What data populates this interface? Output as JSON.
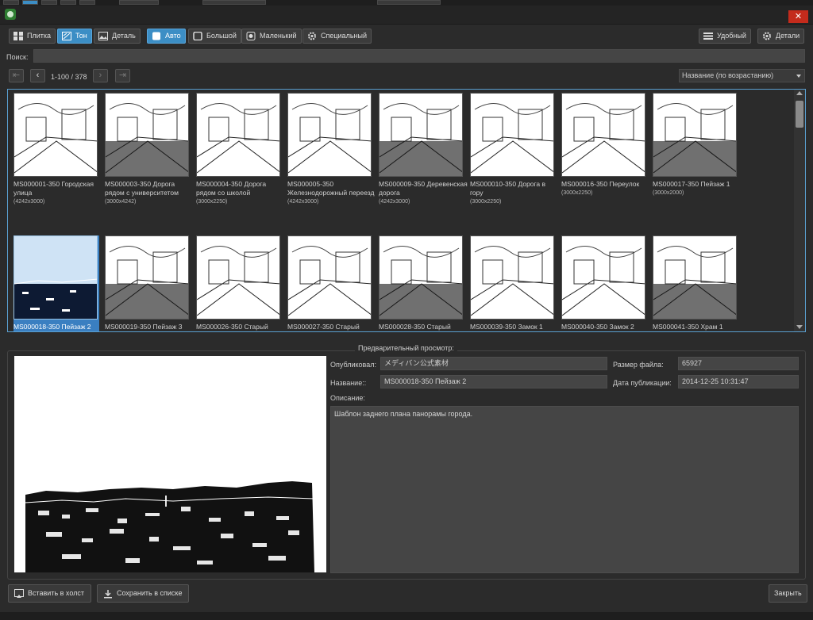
{
  "toolbar": {
    "view_tile": "Плитка",
    "view_tone": "Тон",
    "view_detail": "Деталь",
    "size_auto": "Авто",
    "size_large": "Большой",
    "size_small": "Маленький",
    "size_special": "Специальный",
    "convenient": "Удобный",
    "details": "Детали"
  },
  "search": {
    "label": "Поиск:",
    "value": ""
  },
  "pager": {
    "range": "1-100 / 378",
    "sort": "Название (по возрастанию)"
  },
  "grid": {
    "selected_index": 8,
    "row1": [
      {
        "name": "MS000001-350 Городская улица",
        "size": "(4242x3000)"
      },
      {
        "name": "MS000003-350 Дорога рядом с университетом",
        "size": "(3000x4242)"
      },
      {
        "name": "MS000004-350 Дорога рядом со школой",
        "size": "(3000x2250)"
      },
      {
        "name": "MS000005-350 Железнодорожный переезд",
        "size": "(4242x3000)"
      },
      {
        "name": "MS000009-350 Деревенская дорога",
        "size": "(4242x3000)"
      },
      {
        "name": "MS000010-350 Дорога в гору",
        "size": "(3000x2250)"
      },
      {
        "name": "MS000016-350 Переулок",
        "size": "(3000x2250)"
      },
      {
        "name": "MS000017-350 Пейзаж 1",
        "size": "(3000x2000)"
      }
    ],
    "row2": [
      {
        "name": "MS000018-350 Пейзаж 2"
      },
      {
        "name": "MS000019-350 Пейзаж 3"
      },
      {
        "name": "MS000026-350 Старый"
      },
      {
        "name": "MS000027-350 Старый"
      },
      {
        "name": "MS000028-350 Старый"
      },
      {
        "name": "MS000039-350 Замок 1"
      },
      {
        "name": "MS000040-350 Замок 2"
      },
      {
        "name": "MS000041-350 Храм 1"
      }
    ]
  },
  "preview": {
    "title": "Предварительный просмотр:",
    "publisher_label": "Опубликовал:",
    "publisher": "メディバン公式素材",
    "filesize_label": "Размер файла:",
    "filesize": "65927",
    "name_label": "Название::",
    "name": "MS000018-350 Пейзаж 2",
    "date_label": "Дата публикации:",
    "date": "2014-12-25 10:31:47",
    "desc_label": "Описание:",
    "description": "Шаблон заднего плана панорамы города."
  },
  "buttons": {
    "insert": "Вставить в холст",
    "save": "Сохранить в списке",
    "close": "Закрыть"
  }
}
